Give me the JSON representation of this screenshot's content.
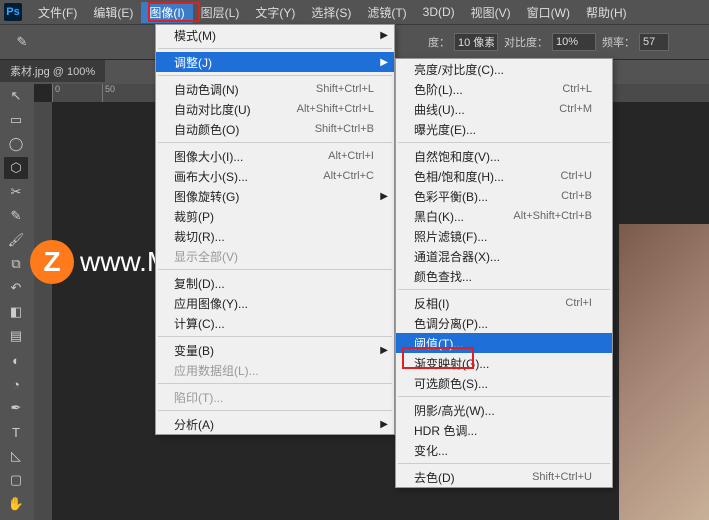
{
  "menubar": {
    "items": [
      {
        "label": "文件(F)"
      },
      {
        "label": "编辑(E)"
      },
      {
        "label": "图像(I)"
      },
      {
        "label": "图层(L)"
      },
      {
        "label": "文字(Y)"
      },
      {
        "label": "选择(S)"
      },
      {
        "label": "滤镜(T)"
      },
      {
        "label": "3D(D)"
      },
      {
        "label": "视图(V)"
      },
      {
        "label": "窗口(W)"
      },
      {
        "label": "帮助(H)"
      }
    ],
    "active_index": 2
  },
  "options_bar": {
    "ratio_label": "度：",
    "ratio_value": "10 像素",
    "contrast_label": "对比度：",
    "contrast_value": "10%",
    "freq_label": "频率：",
    "freq_value": "57"
  },
  "doc_tab": "素材.jpg @ 100%",
  "ruler_ticks": [
    "0",
    "50"
  ],
  "image_menu": {
    "mode": {
      "label": "模式(M)",
      "has_sub": true
    },
    "adjust": {
      "label": "调整(J)",
      "has_sub": true,
      "highlight": true
    },
    "auto_tone": {
      "label": "自动色调(N)",
      "shortcut": "Shift+Ctrl+L"
    },
    "auto_contrast": {
      "label": "自动对比度(U)",
      "shortcut": "Alt+Shift+Ctrl+L"
    },
    "auto_color": {
      "label": "自动颜色(O)",
      "shortcut": "Shift+Ctrl+B"
    },
    "image_size": {
      "label": "图像大小(I)...",
      "shortcut": "Alt+Ctrl+I"
    },
    "canvas_size": {
      "label": "画布大小(S)...",
      "shortcut": "Alt+Ctrl+C"
    },
    "rotate": {
      "label": "图像旋转(G)",
      "has_sub": true
    },
    "crop": {
      "label": "裁剪(P)"
    },
    "trim": {
      "label": "裁切(R)..."
    },
    "reveal": {
      "label": "显示全部(V)"
    },
    "duplicate": {
      "label": "复制(D)..."
    },
    "apply_image": {
      "label": "应用图像(Y)..."
    },
    "calculations": {
      "label": "计算(C)..."
    },
    "variables": {
      "label": "变量(B)",
      "has_sub": true
    },
    "apply_data": {
      "label": "应用数据组(L)...",
      "disabled": true
    },
    "trap": {
      "label": "陷印(T)...",
      "disabled": true
    },
    "analysis": {
      "label": "分析(A)",
      "has_sub": true
    }
  },
  "adjust_submenu": {
    "bc": {
      "label": "亮度/对比度(C)..."
    },
    "levels": {
      "label": "色阶(L)...",
      "shortcut": "Ctrl+L"
    },
    "curves": {
      "label": "曲线(U)...",
      "shortcut": "Ctrl+M"
    },
    "exposure": {
      "label": "曝光度(E)..."
    },
    "vibrance": {
      "label": "自然饱和度(V)..."
    },
    "hsat": {
      "label": "色相/饱和度(H)...",
      "shortcut": "Ctrl+U"
    },
    "cbal": {
      "label": "色彩平衡(B)...",
      "shortcut": "Ctrl+B"
    },
    "bw": {
      "label": "黑白(K)...",
      "shortcut": "Alt+Shift+Ctrl+B"
    },
    "photo_filter": {
      "label": "照片滤镜(F)..."
    },
    "channel_mixer": {
      "label": "通道混合器(X)..."
    },
    "color_lookup": {
      "label": "颜色查找..."
    },
    "invert": {
      "label": "反相(I)",
      "shortcut": "Ctrl+I"
    },
    "posterize": {
      "label": "色调分离(P)..."
    },
    "threshold": {
      "label": "阈值(T)...",
      "highlight": true
    },
    "gradient_map": {
      "label": "渐变映射(G)..."
    },
    "selective": {
      "label": "可选颜色(S)..."
    },
    "shadows": {
      "label": "阴影/高光(W)..."
    },
    "hdr": {
      "label": "HDR 色调..."
    },
    "variations": {
      "label": "变化..."
    },
    "desat": {
      "label": "去色(D)",
      "shortcut": "Shift+Ctrl+U"
    }
  },
  "watermark": {
    "circle": "Z",
    "text": "www.MacZ.com"
  }
}
